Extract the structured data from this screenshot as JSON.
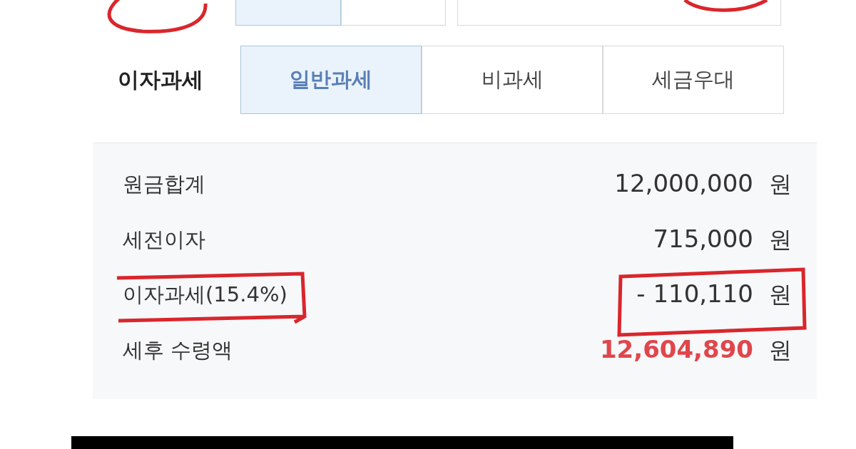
{
  "top_row": {
    "options": [
      {
        "selected": true
      },
      {
        "selected": false
      }
    ]
  },
  "tax_type": {
    "label": "이자과세",
    "options": [
      {
        "label": "일반과세",
        "selected": true
      },
      {
        "label": "비과세",
        "selected": false
      },
      {
        "label": "세금우대",
        "selected": false
      }
    ]
  },
  "summary": [
    {
      "label": "원금합계",
      "value": "12,000,000",
      "unit": "원",
      "highlight": false
    },
    {
      "label": "세전이자",
      "value": "715,000",
      "unit": "원",
      "highlight": false
    },
    {
      "label": "이자과세(15.4%)",
      "value": "- 110,110",
      "unit": "원",
      "highlight": false
    },
    {
      "label": "세후 수령액",
      "value": "12,604,890",
      "unit": "원",
      "highlight": true
    }
  ]
}
